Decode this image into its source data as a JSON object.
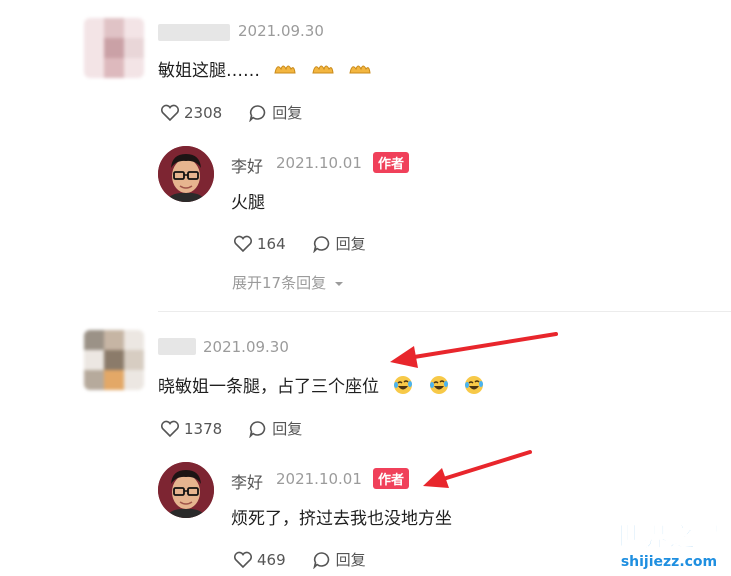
{
  "comments": [
    {
      "date": "2021.09.30",
      "text": "敏姐这腿……",
      "likes": "2308",
      "reply_label": "回复",
      "reply": {
        "author": "李好",
        "date": "2021.10.01",
        "badge": "作者",
        "text": "火腿",
        "likes": "164",
        "reply_label": "回复"
      },
      "expand_label": "展开17条回复"
    },
    {
      "date": "2021.09.30",
      "text": "晓敏姐一条腿，占了三个座位",
      "likes": "1378",
      "reply_label": "回复",
      "reply": {
        "author": "李好",
        "date": "2021.10.01",
        "badge": "作者",
        "text": "烦死了，挤过去我也没地方坐",
        "likes": "469",
        "reply_label": "回复"
      }
    }
  ],
  "watermark": {
    "title": "世界之最",
    "url": "shijiezz.com"
  },
  "colors": {
    "badge": "#f0405a",
    "arrow": "#e8262c",
    "watermark": "#1f8fe0"
  }
}
